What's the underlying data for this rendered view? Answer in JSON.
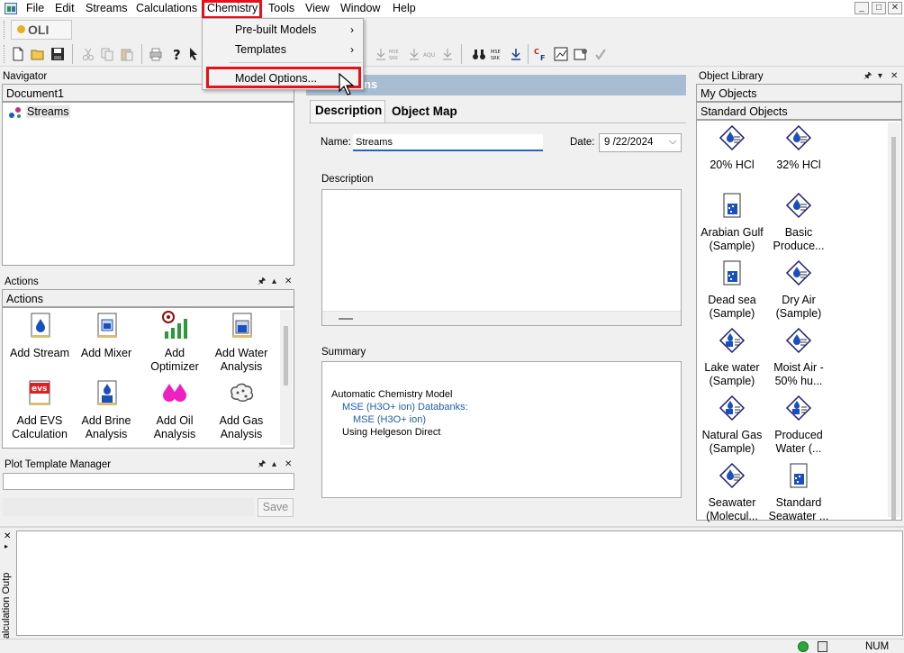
{
  "app": {
    "logo_text": "OLI"
  },
  "menu": {
    "items": [
      "File",
      "Edit",
      "Streams",
      "Calculations",
      "Chemistry",
      "Tools",
      "View",
      "Window",
      "Help"
    ],
    "chemistry_dropdown": {
      "items": [
        {
          "label": "Pre-built Models",
          "submenu": true
        },
        {
          "label": "Templates",
          "submenu": true
        },
        {
          "label": "Model Options...",
          "submenu": false
        }
      ]
    },
    "highlight_color": "#e8101a"
  },
  "navigator": {
    "title": "Navigator",
    "document": "Document1",
    "tree": [
      "Streams"
    ]
  },
  "actions": {
    "title": "Actions",
    "header": "Actions",
    "items": [
      {
        "label1": "Add Stream",
        "label2": "",
        "icon": "stream-icon"
      },
      {
        "label1": "Add Mixer",
        "label2": "",
        "icon": "mixer-icon"
      },
      {
        "label1": "Add",
        "label2": "Optimizer",
        "icon": "optimizer-icon"
      },
      {
        "label1": "Add Water",
        "label2": "Analysis",
        "icon": "water-analysis-icon"
      },
      {
        "label1": "Add EVS",
        "label2": "Calculation",
        "icon": "evs-icon"
      },
      {
        "label1": "Add Brine",
        "label2": "Analysis",
        "icon": "brine-icon"
      },
      {
        "label1": "Add Oil",
        "label2": "Analysis",
        "icon": "oil-icon"
      },
      {
        "label1": "Add Gas",
        "label2": "Analysis",
        "icon": "gas-icon"
      }
    ]
  },
  "plot_template": {
    "title": "Plot Template Manager",
    "save_label": "Save"
  },
  "main": {
    "header_title": "ns",
    "tabs": [
      "Description",
      "Object Map"
    ],
    "name_label": "Name:",
    "name_value": "Streams",
    "date_label": "Date:",
    "date_value": "9 /22/2024",
    "description_label": "Description",
    "summary_label": "Summary",
    "summary_lines": [
      {
        "text": "Automatic Chemistry Model",
        "color": "#000000"
      },
      {
        "text": "MSE (H3O+ ion) Databanks:",
        "color": "#1f5fb0"
      },
      {
        "text": "MSE (H3O+ ion)",
        "color": "#1f5fb0"
      },
      {
        "text": "Using Helgeson Direct",
        "color": "#000000"
      }
    ]
  },
  "object_library": {
    "title": "Object Library",
    "my_objects": "My Objects",
    "standard_objects": "Standard Objects",
    "items": [
      {
        "label1": "20% HCl",
        "label2": "",
        "icon": "flask-icon"
      },
      {
        "label1": "32% HCl",
        "label2": "",
        "icon": "flask-icon"
      },
      {
        "label1": "Arabian Gulf",
        "label2": "(Sample)",
        "icon": "water-analysis-icon"
      },
      {
        "label1": "Basic",
        "label2": "Produce...",
        "icon": "flask-icon"
      },
      {
        "label1": "Dead sea",
        "label2": "(Sample)",
        "icon": "water-analysis-icon"
      },
      {
        "label1": "Dry Air",
        "label2": "(Sample)",
        "icon": "flask-icon"
      },
      {
        "label1": "Lake water",
        "label2": "(Sample)",
        "icon": "flask-water-icon"
      },
      {
        "label1": "Moist Air -",
        "label2": "50% hu...",
        "icon": "flask-icon"
      },
      {
        "label1": "Natural Gas",
        "label2": "(Sample)",
        "icon": "flask-water-icon"
      },
      {
        "label1": "Produced",
        "label2": "Water (...",
        "icon": "flask-water-icon"
      },
      {
        "label1": "Seawater",
        "label2": "(Molecul...",
        "icon": "flask-icon"
      },
      {
        "label1": "Standard",
        "label2": "Seawater ...",
        "icon": "water-analysis-icon"
      }
    ]
  },
  "calc_output": {
    "label": "Calculation Outp"
  },
  "status": {
    "num": "NUM"
  }
}
